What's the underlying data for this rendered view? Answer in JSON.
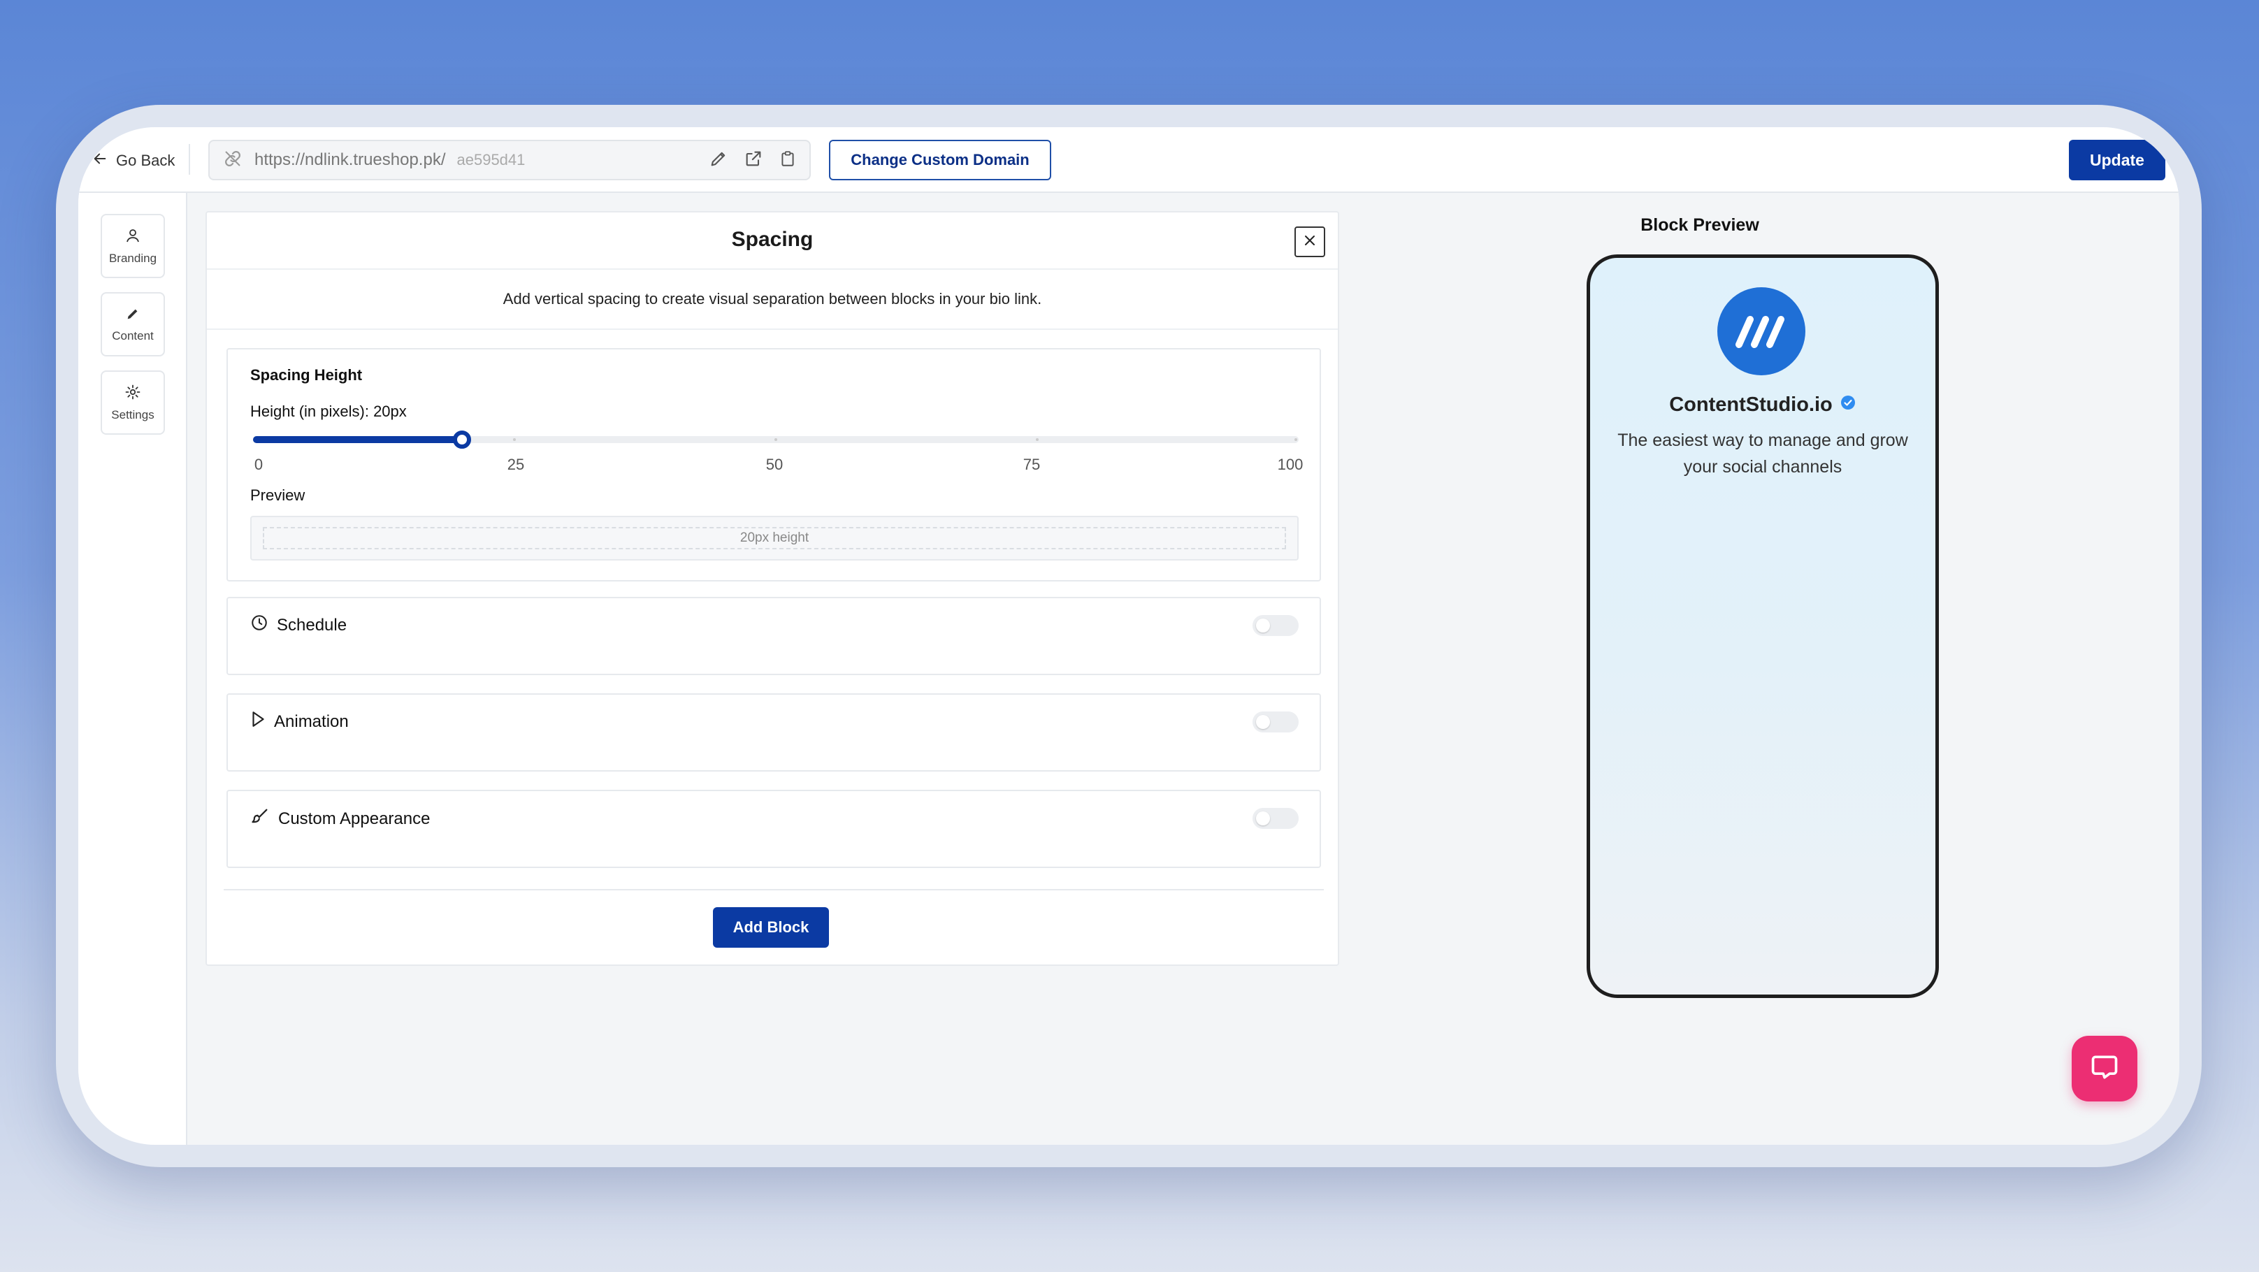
{
  "topbar": {
    "go_back_label": "Go Back",
    "url": "https://ndlink.trueshop.pk/",
    "url_slug": "ae595d41",
    "change_domain_label": "Change Custom Domain",
    "update_label": "Update"
  },
  "sidebar": {
    "items": [
      {
        "label": "Branding",
        "icon": "user-icon"
      },
      {
        "label": "Content",
        "icon": "pencil-icon"
      },
      {
        "label": "Settings",
        "icon": "gear-icon"
      }
    ]
  },
  "panel": {
    "title": "Spacing",
    "description": "Add vertical spacing to create visual separation between blocks in your bio link.",
    "spacing": {
      "section_title": "Spacing Height",
      "height_label": "Height (in pixels): 20px",
      "slider_value": 20,
      "slider_min": 0,
      "slider_max": 100,
      "ticks": [
        "0",
        "25",
        "50",
        "75",
        "100"
      ],
      "preview_label": "Preview",
      "preview_text": "20px height"
    },
    "sections": [
      {
        "label": "Schedule",
        "icon": "clock-icon",
        "enabled": false
      },
      {
        "label": "Animation",
        "icon": "play-icon",
        "enabled": false
      },
      {
        "label": "Custom Appearance",
        "icon": "brush-icon",
        "enabled": false
      }
    ],
    "add_block_label": "Add Block"
  },
  "block_preview": {
    "title": "Block Preview",
    "brand_name": "ContentStudio.io",
    "tagline": "The easiest way to manage and grow your social channels"
  },
  "colors": {
    "primary": "#0b3aa3",
    "logo": "#1f6fd6",
    "chat": "#ec2e73"
  }
}
